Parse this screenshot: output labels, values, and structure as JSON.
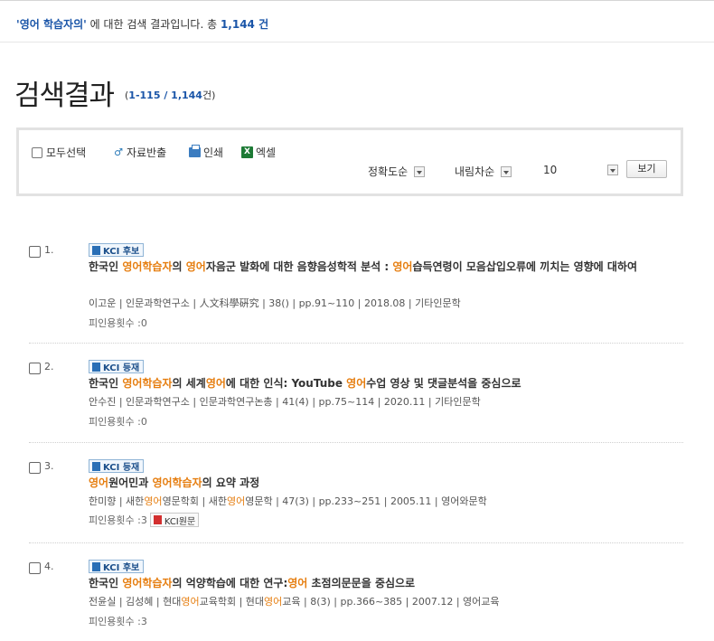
{
  "topbar": {
    "quote_open": "'",
    "keyword": "영어 학습자의",
    "quote_close": "'",
    "mid_text": " 에 대한 검색 결과입니다. 총 ",
    "total": "1,144",
    "unit": " 건"
  },
  "heading": {
    "title": "검색결과",
    "paren_open": "(",
    "range": "1-115",
    "slash": " / ",
    "total": "1,144",
    "unit": "건",
    "paren_close": ")"
  },
  "toolbar": {
    "select_all": "모두선택",
    "export": "자료반출",
    "print": "인쇄",
    "excel": "엑셀",
    "sort_field": "정확도순",
    "sort_order": "내림차순",
    "page_size": "10",
    "view_button": "보기"
  },
  "results": [
    {
      "no": "1.",
      "badge": "KCI 후보",
      "title_segments": [
        {
          "t": "한국인 ",
          "h": false
        },
        {
          "t": "영어학습자",
          "h": true
        },
        {
          "t": "의 ",
          "h": false
        },
        {
          "t": "영어",
          "h": true
        },
        {
          "t": "자음군 발화에 대한 음향음성학적 분석 : ",
          "h": false
        },
        {
          "t": "영어",
          "h": true
        },
        {
          "t": "습득연령이 모음삽입오류에 끼치는 영향에 대하여",
          "h": false
        }
      ],
      "meta": "이고운 | 인문과학연구소 | 人文科學硏究 | 38() | pp.91~110 | 2018.08 | 기타인문학",
      "cite_label": "피인용횟수 : ",
      "cite_count": "0"
    },
    {
      "no": "2.",
      "badge": "KCI 등재",
      "title_segments": [
        {
          "t": "한국인 ",
          "h": false
        },
        {
          "t": "영어학습자",
          "h": true
        },
        {
          "t": "의 세계",
          "h": false
        },
        {
          "t": "영어",
          "h": true
        },
        {
          "t": "에 대한 인식: YouTube ",
          "h": false
        },
        {
          "t": "영어",
          "h": true
        },
        {
          "t": "수업 영상 및 댓글분석을 중심으로",
          "h": false
        }
      ],
      "meta": "안수진 | 인문과학연구소 | 인문과학연구논총 | 41(4) | pp.75~114 | 2020.11 | 기타인문학",
      "cite_label": "피인용횟수 : ",
      "cite_count": "0"
    },
    {
      "no": "3.",
      "badge": "KCI 등재",
      "title_segments": [
        {
          "t": "영어",
          "h": true
        },
        {
          "t": "원어민과 ",
          "h": false
        },
        {
          "t": "영어학습자",
          "h": true
        },
        {
          "t": "의 요약 과정",
          "h": false
        }
      ],
      "meta_segments": [
        {
          "t": "한미향 | 새한",
          "h": false
        },
        {
          "t": "영어",
          "h": true
        },
        {
          "t": "영문학회 | 새한",
          "h": false
        },
        {
          "t": "영어",
          "h": true
        },
        {
          "t": "영문학 | 47(3) | pp.233~251 | 2005.11 | 영어와문학",
          "h": false
        }
      ],
      "cite_label": "피인용횟수 : ",
      "cite_count": "3",
      "pdf_button": "KCI원문"
    },
    {
      "no": "4.",
      "badge": "KCI 후보",
      "title_segments": [
        {
          "t": "한국인 ",
          "h": false
        },
        {
          "t": "영어학습자",
          "h": true
        },
        {
          "t": "의 억양학습에 대한 연구:",
          "h": false
        },
        {
          "t": "영어",
          "h": true
        },
        {
          "t": " 초점의문문을 중심으로",
          "h": false
        }
      ],
      "meta_segments": [
        {
          "t": "전윤실 | 김성혜 | 현대",
          "h": false
        },
        {
          "t": "영어",
          "h": true
        },
        {
          "t": "교육학회 | 현대",
          "h": false
        },
        {
          "t": "영어",
          "h": true
        },
        {
          "t": "교육 | 8(3) | pp.366~385 | 2007.12 | 영어교육",
          "h": false
        }
      ],
      "cite_label": "피인용횟수 : ",
      "cite_count": "3"
    }
  ],
  "colors": {
    "accent": "#1a55a8",
    "highlight": "#e67e10"
  }
}
